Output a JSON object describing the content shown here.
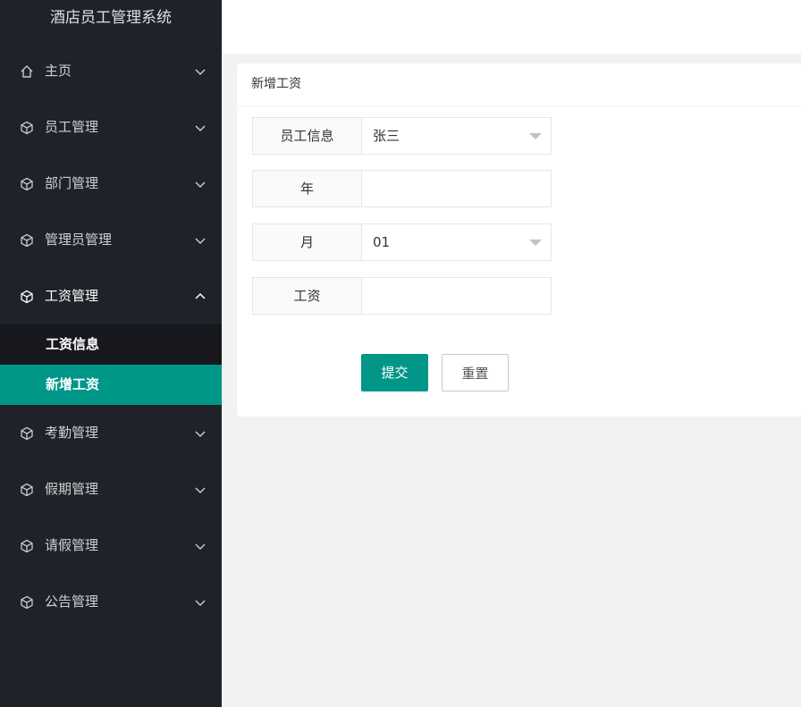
{
  "app": {
    "title": "酒店员工管理系统"
  },
  "sidebar": {
    "items": [
      {
        "label": "主页",
        "icon": "home-icon"
      },
      {
        "label": "员工管理",
        "icon": "cube-icon"
      },
      {
        "label": "部门管理",
        "icon": "cube-icon"
      },
      {
        "label": "管理员管理",
        "icon": "cube-icon"
      },
      {
        "label": "工资管理",
        "icon": "cube-icon",
        "expanded": true,
        "children": [
          {
            "label": "工资信息"
          },
          {
            "label": "新增工资",
            "active": true
          }
        ]
      },
      {
        "label": "考勤管理",
        "icon": "cube-icon"
      },
      {
        "label": "假期管理",
        "icon": "cube-icon"
      },
      {
        "label": "请假管理",
        "icon": "cube-icon"
      },
      {
        "label": "公告管理",
        "icon": "cube-icon"
      }
    ]
  },
  "form": {
    "title": "新增工资",
    "fields": [
      {
        "label": "员工信息",
        "value": "张三",
        "type": "select"
      },
      {
        "label": "年",
        "value": "",
        "type": "text"
      },
      {
        "label": "月",
        "value": "01",
        "type": "select"
      },
      {
        "label": "工资",
        "value": "",
        "type": "text"
      }
    ],
    "submit_label": "提交",
    "reset_label": "重置"
  },
  "colors": {
    "sidebar_bg": "#20222a",
    "accent": "#009688",
    "submenu_bg": "#17181d"
  }
}
